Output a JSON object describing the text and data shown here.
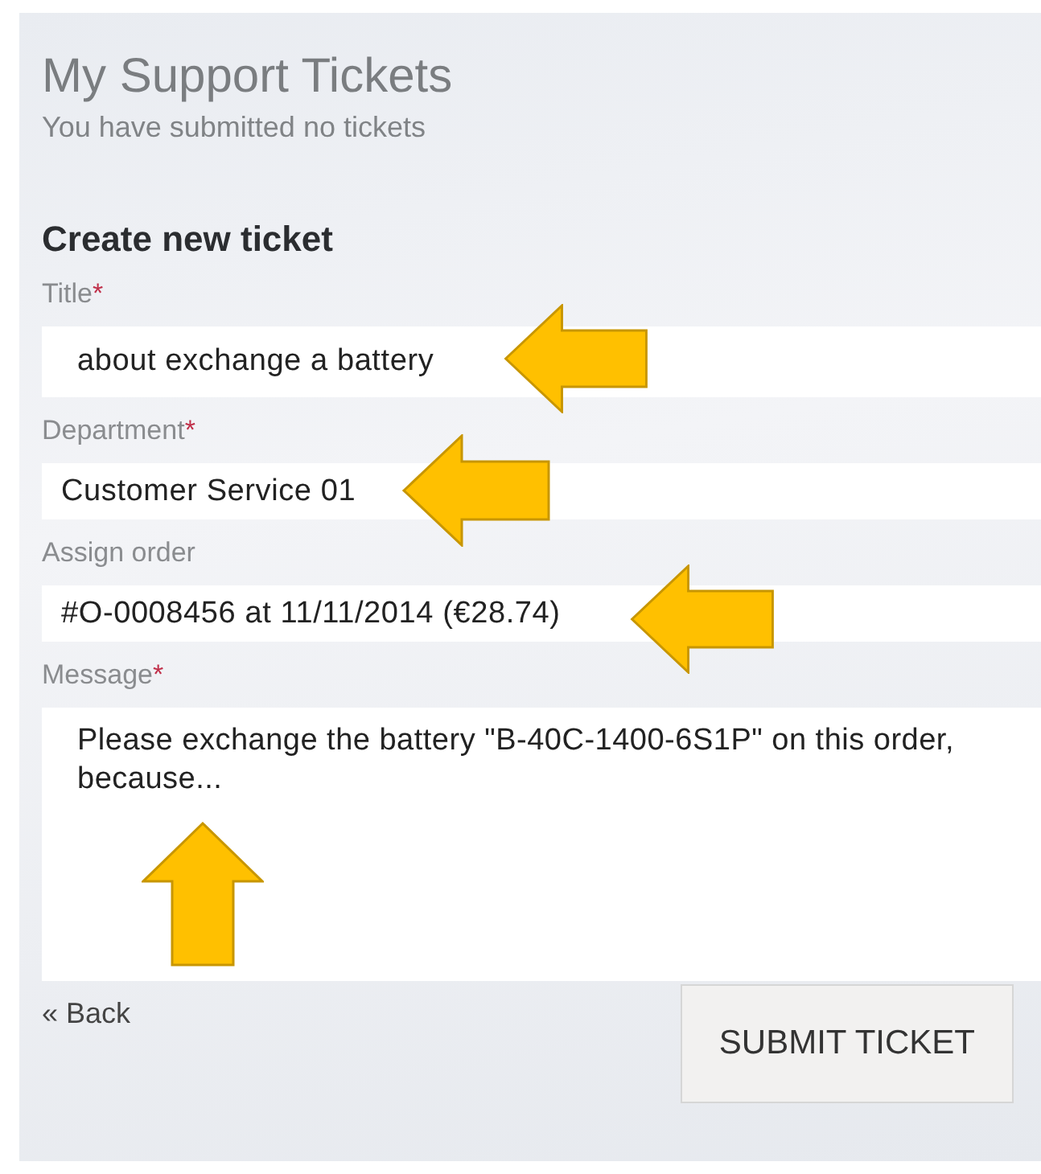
{
  "page": {
    "title": "My Support Tickets",
    "subtitle": "You have submitted no tickets"
  },
  "form": {
    "heading": "Create new ticket",
    "fields": [
      {
        "kind": "input",
        "label": "Title",
        "required_mark": "*",
        "value": "about exchange a battery"
      },
      {
        "kind": "input",
        "label": "Department",
        "required_mark": "*",
        "value": "Customer Service 01"
      },
      {
        "kind": "input",
        "label": "Assign order",
        "value": "#O-0008456 at 11/11/2014 (€28.74)"
      },
      {
        "kind": "textarea",
        "label": "Message",
        "required_mark": "*",
        "value": "Please exchange the battery \"B-40C-1400-6S1P\" on this order,\nbecause..."
      }
    ],
    "back_link": "« Back",
    "submit": "SUBMIT TICKET"
  }
}
